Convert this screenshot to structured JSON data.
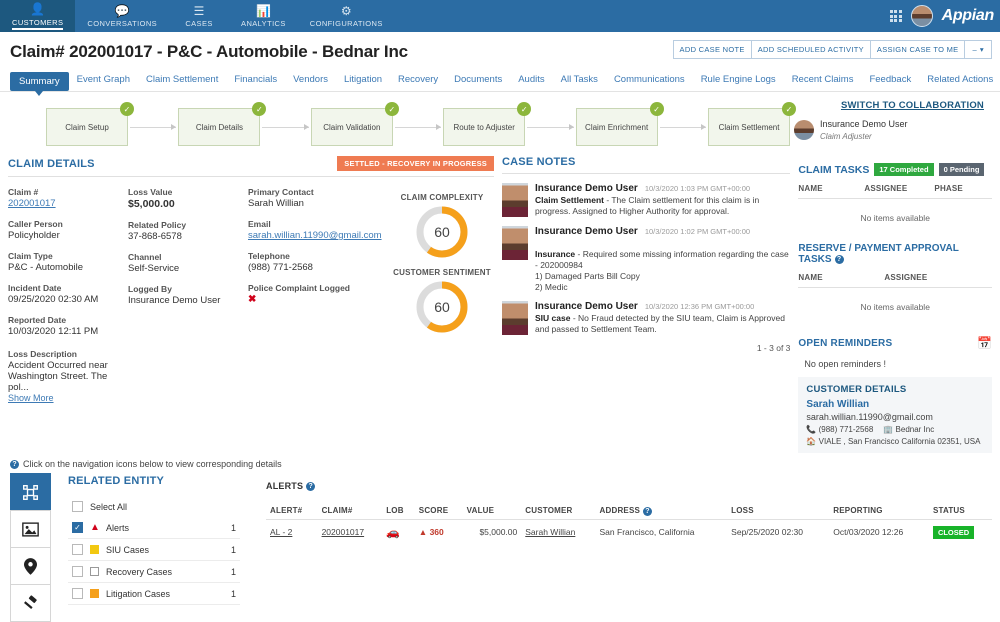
{
  "topnav": {
    "items": [
      {
        "label": "CUSTOMERS",
        "icon": "person-icon",
        "active": true
      },
      {
        "label": "CONVERSATIONS",
        "icon": "chat-icon",
        "active": false
      },
      {
        "label": "CASES",
        "icon": "list-icon",
        "active": false
      },
      {
        "label": "ANALYTICS",
        "icon": "bar-chart-icon",
        "active": false
      },
      {
        "label": "CONFIGURATIONS",
        "icon": "gears-icon",
        "active": false
      }
    ],
    "brand": "Appian"
  },
  "header": {
    "title": "Claim# 202001017 - P&C - Automobile - Bednar Inc",
    "buttons": [
      {
        "label": "ADD CASE NOTE"
      },
      {
        "label": "ADD SCHEDULED ACTIVITY"
      },
      {
        "label": "ASSIGN CASE TO ME"
      }
    ],
    "more_label": "–"
  },
  "tabs": [
    {
      "label": "Summary",
      "active": true
    },
    {
      "label": "Event Graph",
      "active": false
    },
    {
      "label": "Claim Settlement",
      "active": false
    },
    {
      "label": "Financials",
      "active": false
    },
    {
      "label": "Vendors",
      "active": false
    },
    {
      "label": "Litigation",
      "active": false
    },
    {
      "label": "Recovery",
      "active": false
    },
    {
      "label": "Documents",
      "active": false
    },
    {
      "label": "Audits",
      "active": false
    },
    {
      "label": "All Tasks",
      "active": false
    },
    {
      "label": "Communications",
      "active": false
    },
    {
      "label": "Rule Engine Logs",
      "active": false
    },
    {
      "label": "Recent Claims",
      "active": false
    },
    {
      "label": "Feedback",
      "active": false
    },
    {
      "label": "Related Actions",
      "active": false
    }
  ],
  "milestones": [
    {
      "label": "Claim Setup",
      "complete": true
    },
    {
      "label": "Claim Details",
      "complete": true
    },
    {
      "label": "Claim Validation",
      "complete": true
    },
    {
      "label": "Route to Adjuster",
      "complete": true
    },
    {
      "label": "Claim Enrichment",
      "complete": true
    },
    {
      "label": "Claim Settlement",
      "complete": true
    }
  ],
  "claim_details": {
    "title": "CLAIM DETAILS",
    "status_badge": "SETTLED - RECOVERY IN PROGRESS",
    "col1": [
      {
        "label": "Claim #",
        "value": "202001017",
        "type": "link"
      },
      {
        "label": "Caller Person",
        "value": "Policyholder"
      },
      {
        "label": "Claim Type",
        "value": "P&C - Automobile"
      },
      {
        "label": "Incident Date",
        "value": "09/25/2020 02:30 AM"
      },
      {
        "label": "Reported Date",
        "value": "10/03/2020 12:11 PM"
      }
    ],
    "col2": [
      {
        "label": "Loss Value",
        "value": "$5,000.00",
        "type": "strong"
      },
      {
        "label": "Related Policy",
        "value": "37-868-6578"
      },
      {
        "label": "Channel",
        "value": "Self-Service"
      },
      {
        "label": "Logged By",
        "value": "Insurance Demo User"
      }
    ],
    "col3": [
      {
        "label": "Primary Contact",
        "value": "Sarah Willian"
      },
      {
        "label": "Email",
        "value": "sarah.willian.11990@gmail.com",
        "type": "link"
      },
      {
        "label": "Telephone",
        "value": "(988) 771-2568"
      },
      {
        "label": "Police Complaint Logged",
        "value": "✖",
        "type": "xmark"
      }
    ],
    "loss_description_label": "Loss Description",
    "loss_description": "Accident Occurred near Washington Street. The pol...",
    "show_more": "Show More"
  },
  "gauges": [
    {
      "title": "CLAIM COMPLEXITY",
      "value": 60,
      "color": "#f5a01b"
    },
    {
      "title": "CUSTOMER SENTIMENT",
      "value": 60,
      "color": "#f5a01b"
    }
  ],
  "case_notes": {
    "title": "CASE NOTES",
    "pager": "1 - 3 of 3",
    "items": [
      {
        "author": "Insurance Demo User",
        "time": "10/3/2020 1:03 PM GMT+00:00",
        "subject": "Claim Settlement",
        "text": " - The Claim settlement for this claim is in progress. Assigned to Higher Authority for approval."
      },
      {
        "author": "Insurance Demo User",
        "time": "10/3/2020 1:02 PM GMT+00:00",
        "subject": "Insurance",
        "text": " - Required some missing information regarding the case - 202000984\n1) Damaged Parts Bill Copy\n2) Medic"
      },
      {
        "author": "Insurance Demo User",
        "time": "10/3/2020 12:36 PM GMT+00:00",
        "subject": "SIU case",
        "text": " - No Fraud detected by the SIU team, Claim is Approved and passed to Settlement Team."
      }
    ]
  },
  "right": {
    "switch_label": "SWITCH TO COLLABORATION",
    "user_name": "Insurance Demo User",
    "user_role": "Claim Adjuster",
    "claim_tasks": {
      "title": "CLAIM TASKS",
      "completed_pill": "17 Completed",
      "pending_pill": "0 Pending",
      "columns": [
        "NAME",
        "ASSIGNEE",
        "PHASE"
      ],
      "empty": "No items available"
    },
    "reserve_tasks": {
      "title": "RESERVE / PAYMENT APPROVAL TASKS",
      "columns": [
        "NAME",
        "ASSIGNEE"
      ],
      "empty": "No items available"
    },
    "reminders": {
      "title": "OPEN REMINDERS",
      "empty": "No open reminders !",
      "icon": "calendar-add-icon"
    },
    "customer": {
      "title": "CUSTOMER DETAILS",
      "name": "Sarah Willian",
      "email": "sarah.willian.11990@gmail.com",
      "phone": "(988) 771-2568",
      "company": "Bednar Inc",
      "address": "VIALE , San Francisco California 02351, USA"
    }
  },
  "related_entity": {
    "hint": "Click on the navigation icons below to view corresponding details",
    "title": "RELATED ENTITY",
    "rail": [
      {
        "icon": "entity-icon",
        "active": true
      },
      {
        "icon": "image-icon",
        "active": false
      },
      {
        "icon": "location-pin-icon",
        "active": false
      },
      {
        "icon": "gavel-icon",
        "active": false
      }
    ],
    "select_all": "Select All",
    "rows": [
      {
        "label": "Alerts",
        "count": "1",
        "checked": true,
        "color": "#d0021b",
        "icon": "warning-icon"
      },
      {
        "label": "SIU Cases",
        "count": "1",
        "checked": false,
        "color": "#f2c811",
        "icon": "flag-icon"
      },
      {
        "label": "Recovery Cases",
        "count": "1",
        "checked": false,
        "color": "#ffffff",
        "icon": "box-icon"
      },
      {
        "label": "Litigation Cases",
        "count": "1",
        "checked": false,
        "color": "#f5a01b",
        "icon": "flag-icon"
      }
    ]
  },
  "alerts_table": {
    "title": "ALERTS",
    "columns": [
      "ALERT#",
      "CLAIM#",
      "LOB",
      "SCORE",
      "VALUE",
      "CUSTOMER",
      "ADDRESS",
      "LOSS",
      "REPORTING",
      "STATUS"
    ],
    "rows": [
      {
        "alert": "AL - 2",
        "claim": "202001017",
        "lob": "car-icon",
        "score": "360",
        "value": "$5,000.00",
        "customer": "Sarah Willian",
        "address": "San Francisco, California",
        "loss": "Sep/25/2020 02:30",
        "reporting": "Oct/03/2020 12:26",
        "status": "CLOSED"
      }
    ]
  }
}
